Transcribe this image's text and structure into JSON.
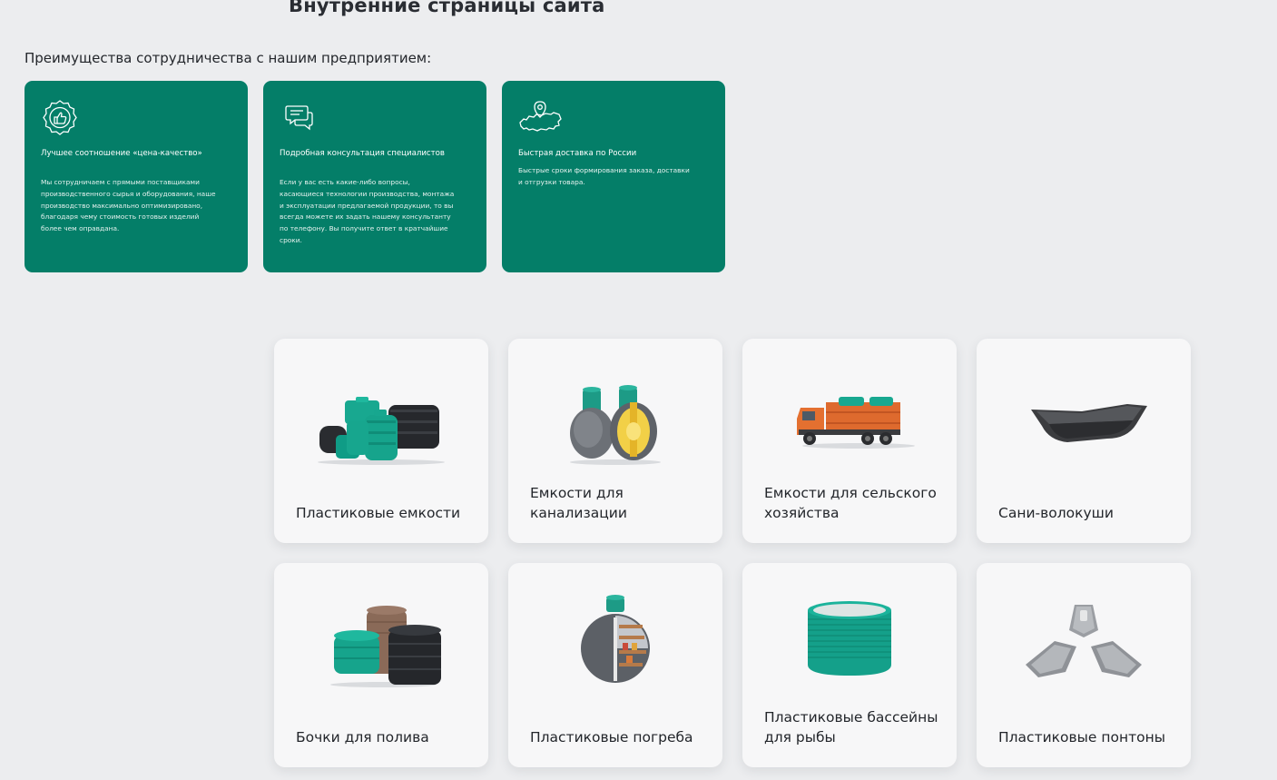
{
  "page_title": "Внутренние страницы сайта",
  "benefits": {
    "heading": "Преимущества сотрудничества с нашим предприятием:",
    "items": [
      {
        "icon": "thumbs-up-badge-icon",
        "title": "Лучшее соотношение «цена-качество»",
        "text": "Мы сотрудничаем с прямыми поставщиками производственного сырья и оборудования, наше производство максимально оптимизировано, благодаря чему стоимость готовых изделий более чем оправдана."
      },
      {
        "icon": "chat-bubbles-icon",
        "title": "Подробная консультация специалистов",
        "text": "Если у вас есть какие-либо вопросы, касающиеся технологии производства, монтажа и эксплуатации предлагаемой продукции, то вы всегда можете их задать нашему консультанту по телефону. Вы получите ответ в кратчайшие сроки."
      },
      {
        "icon": "russia-map-pin-icon",
        "title": "Быстрая доставка  по России",
        "text": "Быстрые сроки формирования заказа, доставки и отгрузки товара."
      }
    ]
  },
  "catalog": {
    "items": [
      {
        "label": "Пластиковые емкости",
        "image": "plastic-tanks-image"
      },
      {
        "label": "Емкости для канализации",
        "image": "sewage-tanks-image"
      },
      {
        "label": "Емкости для сельского хозяйства",
        "image": "agricultural-truck-tank-image"
      },
      {
        "label": "Сани-волокуши",
        "image": "drag-sled-image"
      },
      {
        "label": "Бочки для полива",
        "image": "watering-barrels-image"
      },
      {
        "label": "Пластиковые погреба",
        "image": "plastic-cellar-image"
      },
      {
        "label": "Пластиковые бассейны для рыбы",
        "image": "fish-pool-image"
      },
      {
        "label": "Пластиковые понтоны",
        "image": "plastic-pontoons-image"
      }
    ]
  },
  "colors": {
    "background": "#ecedef",
    "accent_green": "#047e68",
    "card_background": "#f7f7f8",
    "product_teal": "#1aa58e"
  }
}
